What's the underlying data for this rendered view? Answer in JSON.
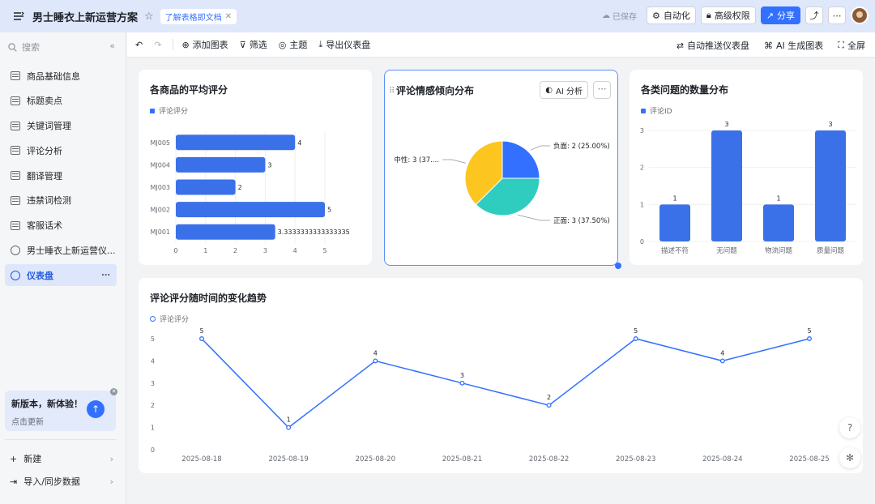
{
  "header": {
    "title": "男士睡衣上新运营方案",
    "doc_tag": "了解表格即文档",
    "saved": "已保存",
    "automation": "自动化",
    "advanced_perm": "高级权限",
    "share": "分享"
  },
  "sidebar": {
    "search_placeholder": "搜索",
    "items": [
      {
        "label": "商品基础信息",
        "icon": "table-icon"
      },
      {
        "label": "标题卖点",
        "icon": "table-icon"
      },
      {
        "label": "关键词管理",
        "icon": "table-icon"
      },
      {
        "label": "评论分析",
        "icon": "table-icon"
      },
      {
        "label": "翻译管理",
        "icon": "table-icon"
      },
      {
        "label": "违禁词检测",
        "icon": "table-icon"
      },
      {
        "label": "客服话术",
        "icon": "table-icon"
      },
      {
        "label": "男士睡衣上新运营仪...",
        "icon": "dashboard-icon"
      },
      {
        "label": "仪表盘",
        "icon": "dashboard-icon",
        "active": true
      }
    ],
    "promo": {
      "title": "新版本，新体验！",
      "subtitle": "点击更新"
    },
    "new_label": "新建",
    "import_label": "导入/同步数据"
  },
  "toolbar": {
    "add_chart": "添加图表",
    "filter": "筛选",
    "theme": "主题",
    "export": "导出仪表盘",
    "auto_push": "自动推送仪表盘",
    "ai_generate": "AI 生成图表",
    "fullscreen": "全屏"
  },
  "cards": {
    "avg_rating": {
      "title": "各商品的平均评分",
      "legend": "评论评分"
    },
    "sentiment": {
      "title": "评论情感倾向分布",
      "ai_button": "AI 分析"
    },
    "issue_count": {
      "title": "各类问题的数量分布",
      "legend": "评论ID"
    },
    "trend": {
      "title": "评论评分随时间的变化趋势",
      "legend": "评论评分"
    }
  },
  "colors": {
    "primary": "#3370ff",
    "teal": "#2ecdc0",
    "yellow": "#fdc520",
    "bar": "#3b71e8"
  },
  "chart_data": [
    {
      "type": "bar",
      "orientation": "horizontal",
      "title": "各商品的平均评分",
      "categories": [
        "MJ005",
        "MJ004",
        "MJ003",
        "MJ002",
        "MJ001"
      ],
      "series": [
        {
          "name": "评论评分",
          "values": [
            4,
            3,
            2,
            5,
            3.3333333333333335
          ]
        }
      ],
      "data_labels": [
        "4",
        "3",
        "2",
        "5",
        "3.3333333333333335"
      ],
      "xlim": [
        0,
        5
      ],
      "xticks": [
        "0",
        "1",
        "2",
        "3",
        "4",
        "5"
      ]
    },
    {
      "type": "pie",
      "title": "评论情感倾向分布",
      "slices": [
        {
          "label": "负面: 2 (25.00%)",
          "value": 2,
          "color": "#3370ff"
        },
        {
          "label": "正面: 3 (37.50%)",
          "value": 3,
          "color": "#2ecdc0"
        },
        {
          "label": "中性: 3 (37....",
          "value": 3,
          "color": "#fdc520"
        }
      ]
    },
    {
      "type": "bar",
      "title": "各类问题的数量分布",
      "categories": [
        "描述不符",
        "无问题",
        "物流问题",
        "质量问题"
      ],
      "series": [
        {
          "name": "评论ID",
          "values": [
            1,
            3,
            1,
            3
          ]
        }
      ],
      "ylim": [
        0,
        3
      ],
      "yticks": [
        "0",
        "1",
        "2",
        "3"
      ]
    },
    {
      "type": "line",
      "title": "评论评分随时间的变化趋势",
      "categories": [
        "2025-08-18",
        "2025-08-19",
        "2025-08-20",
        "2025-08-21",
        "2025-08-22",
        "2025-08-23",
        "2025-08-24",
        "2025-08-25"
      ],
      "series": [
        {
          "name": "评论评分",
          "values": [
            5,
            1,
            4,
            3,
            2,
            5,
            4,
            5
          ]
        }
      ],
      "ylim": [
        0,
        5
      ],
      "yticks": [
        "0",
        "1",
        "2",
        "3",
        "4",
        "5"
      ]
    }
  ]
}
